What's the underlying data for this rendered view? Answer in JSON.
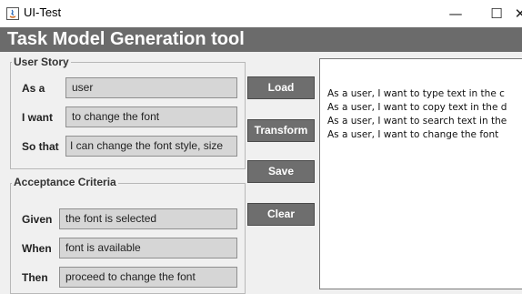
{
  "window": {
    "title": "UI-Test",
    "controls": {
      "minimize": "—",
      "maximize": "☐",
      "close": "✕"
    }
  },
  "header": {
    "title": "Task Model Generation tool"
  },
  "user_story": {
    "legend": "User Story",
    "rows": [
      {
        "label": "As a",
        "value": "user"
      },
      {
        "label": "I want",
        "value": "to change the font"
      },
      {
        "label": "So that",
        "value": "I can change the font style, size"
      }
    ]
  },
  "acceptance": {
    "legend": "Acceptance Criteria",
    "rows": [
      {
        "label": "Given",
        "value": "the font is selected"
      },
      {
        "label": "When",
        "value": "font is available"
      },
      {
        "label": "Then",
        "value": "proceed to change the font"
      }
    ]
  },
  "buttons": {
    "load": "Load",
    "transform": "Transform",
    "save": "Save",
    "clear": "Clear"
  },
  "output": {
    "lines": [
      "As a user, I want to type text in the c",
      "As a user, I want to copy text in the d",
      "As a user, I want to search text in the",
      "As a user, I want to change the font"
    ]
  },
  "colors": {
    "header_bg": "#6b6b6b",
    "button_bg": "#6e6e6e",
    "field_bg": "#d6d6d6"
  }
}
